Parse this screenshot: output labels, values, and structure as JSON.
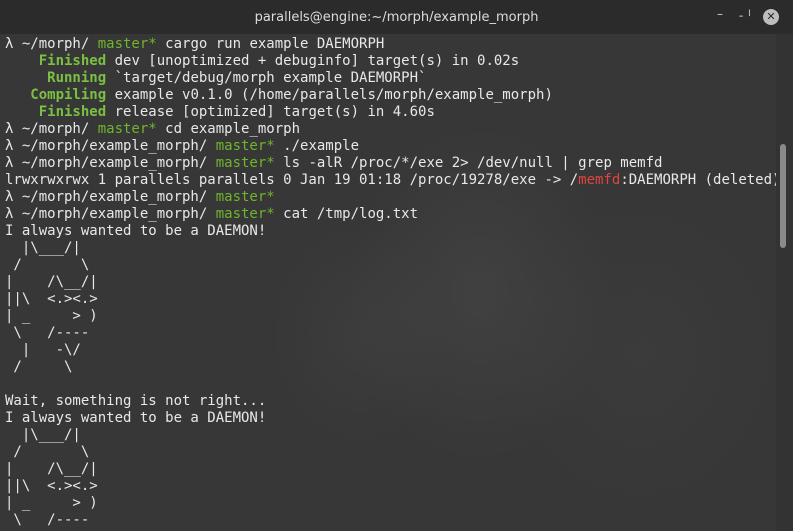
{
  "window": {
    "title": "parallels@engine:~/morph/example_morph",
    "minimize_icon": "minimize-icon",
    "maximize_icon": "maximize-icon",
    "close_icon": "close-icon"
  },
  "terminal": {
    "lines": [
      {
        "kind": "prompt",
        "path": "λ ~/morph/ ",
        "branch": "master*",
        "cmd": " cargo run example DAEMORPH"
      },
      {
        "kind": "status",
        "label": "    Finished",
        "text": " dev [unoptimized + debuginfo] target(s) in 0.02s"
      },
      {
        "kind": "status",
        "label": "     Running",
        "text": " `target/debug/morph example DAEMORPH`"
      },
      {
        "kind": "status",
        "label": "   Compiling",
        "text": " example v0.1.0 (/home/parallels/morph/example_morph)"
      },
      {
        "kind": "status",
        "label": "    Finished",
        "text": " release [optimized] target(s) in 4.60s"
      },
      {
        "kind": "prompt",
        "path": "λ ~/morph/ ",
        "branch": "master*",
        "cmd": " cd example_morph"
      },
      {
        "kind": "prompt",
        "path": "λ ~/morph/example_morph/ ",
        "branch": "master*",
        "cmd": " ./example"
      },
      {
        "kind": "prompt",
        "path": "λ ~/morph/example_morph/ ",
        "branch": "master*",
        "cmd": " ls -alR /proc/*/exe 2> /dev/null | grep memfd"
      },
      {
        "kind": "ls",
        "pre": "lrwxrwxrwx 1 parallels parallels 0 Jan 19 01:18 /proc/19278/exe -> /",
        "hl": "memfd",
        "post": ":DAEMORPH (deleted)"
      },
      {
        "kind": "prompt",
        "path": "λ ~/morph/example_morph/ ",
        "branch": "master*",
        "cmd": ""
      },
      {
        "kind": "prompt",
        "path": "λ ~/morph/example_morph/ ",
        "branch": "master*",
        "cmd": " cat /tmp/log.txt"
      },
      {
        "kind": "text",
        "text": "I always wanted to be a DAEMON!"
      },
      {
        "kind": "text",
        "text": "  |\\___/|"
      },
      {
        "kind": "text",
        "text": " /       \\"
      },
      {
        "kind": "text",
        "text": "|    /\\__/|"
      },
      {
        "kind": "text",
        "text": "||\\  <.><.>"
      },
      {
        "kind": "text",
        "text": "| _     > )"
      },
      {
        "kind": "text",
        "text": " \\   /----"
      },
      {
        "kind": "text",
        "text": "  |   -\\/"
      },
      {
        "kind": "text",
        "text": " /     \\"
      },
      {
        "kind": "text",
        "text": ""
      },
      {
        "kind": "text",
        "text": "Wait, something is not right..."
      },
      {
        "kind": "text",
        "text": "I always wanted to be a DAEMON!"
      },
      {
        "kind": "text",
        "text": "  |\\___/|"
      },
      {
        "kind": "text",
        "text": " /       \\"
      },
      {
        "kind": "text",
        "text": "|    /\\__/|"
      },
      {
        "kind": "text",
        "text": "||\\  <.><.>"
      },
      {
        "kind": "text",
        "text": "| _     > )"
      },
      {
        "kind": "text",
        "text": " \\   /----"
      }
    ]
  },
  "colors": {
    "branch": "#6fb52c",
    "status": "#7bc043",
    "highlight": "#e0453a"
  }
}
